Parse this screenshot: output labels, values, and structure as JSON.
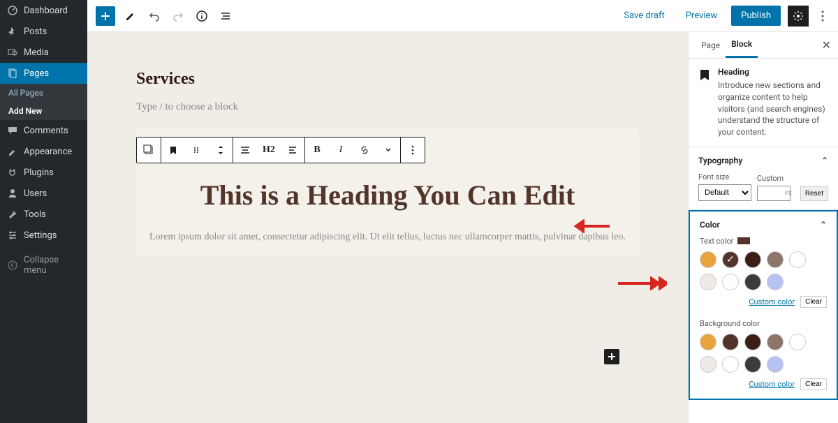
{
  "sidebar": {
    "items": [
      {
        "label": "Dashboard",
        "icon": "dashboard"
      },
      {
        "label": "Posts",
        "icon": "pin"
      },
      {
        "label": "Media",
        "icon": "media"
      },
      {
        "label": "Pages",
        "icon": "page",
        "active": true
      },
      {
        "label": "Comments",
        "icon": "comment"
      },
      {
        "label": "Appearance",
        "icon": "brush"
      },
      {
        "label": "Plugins",
        "icon": "plug"
      },
      {
        "label": "Users",
        "icon": "user"
      },
      {
        "label": "Tools",
        "icon": "wrench"
      },
      {
        "label": "Settings",
        "icon": "sliders"
      }
    ],
    "sub_items": [
      {
        "label": "All Pages"
      },
      {
        "label": "Add New",
        "selected": true
      }
    ],
    "collapse_label": "Collapse menu"
  },
  "topbar": {
    "save_draft": "Save draft",
    "preview": "Preview",
    "publish": "Publish"
  },
  "editor": {
    "page_title": "Services",
    "placeholder": "Type / to choose a block",
    "heading_text": "This is a Heading You Can Edit",
    "paragraph": "Lorem ipsum dolor sit amet, consectetur adipiscing elit. Ut elit tellus, luctus nec ullamcorper mattis, pulvinar dapibus leo.",
    "toolbar_h2": "H2"
  },
  "inspector": {
    "tabs": {
      "page": "Page",
      "block": "Block"
    },
    "block_info": {
      "title": "Heading",
      "desc": "Introduce new sections and organize content to help visitors (and search engines) understand the structure of your content."
    },
    "typography": {
      "title": "Typography",
      "font_size_label": "Font size",
      "custom_label": "Custom",
      "default_option": "Default",
      "px_unit": "PX",
      "reset": "Reset"
    },
    "color": {
      "title": "Color",
      "text_color_label": "Text color",
      "bg_color_label": "Background color",
      "custom_link": "Custom color",
      "clear": "Clear",
      "swatches": [
        "#e8a33d",
        "#52342a",
        "#3b1e15",
        "#8c7468",
        "#ffffff",
        "#f1e9e3",
        "#ffffff",
        "#3b3b3b",
        "#b6c3f2"
      ]
    }
  }
}
